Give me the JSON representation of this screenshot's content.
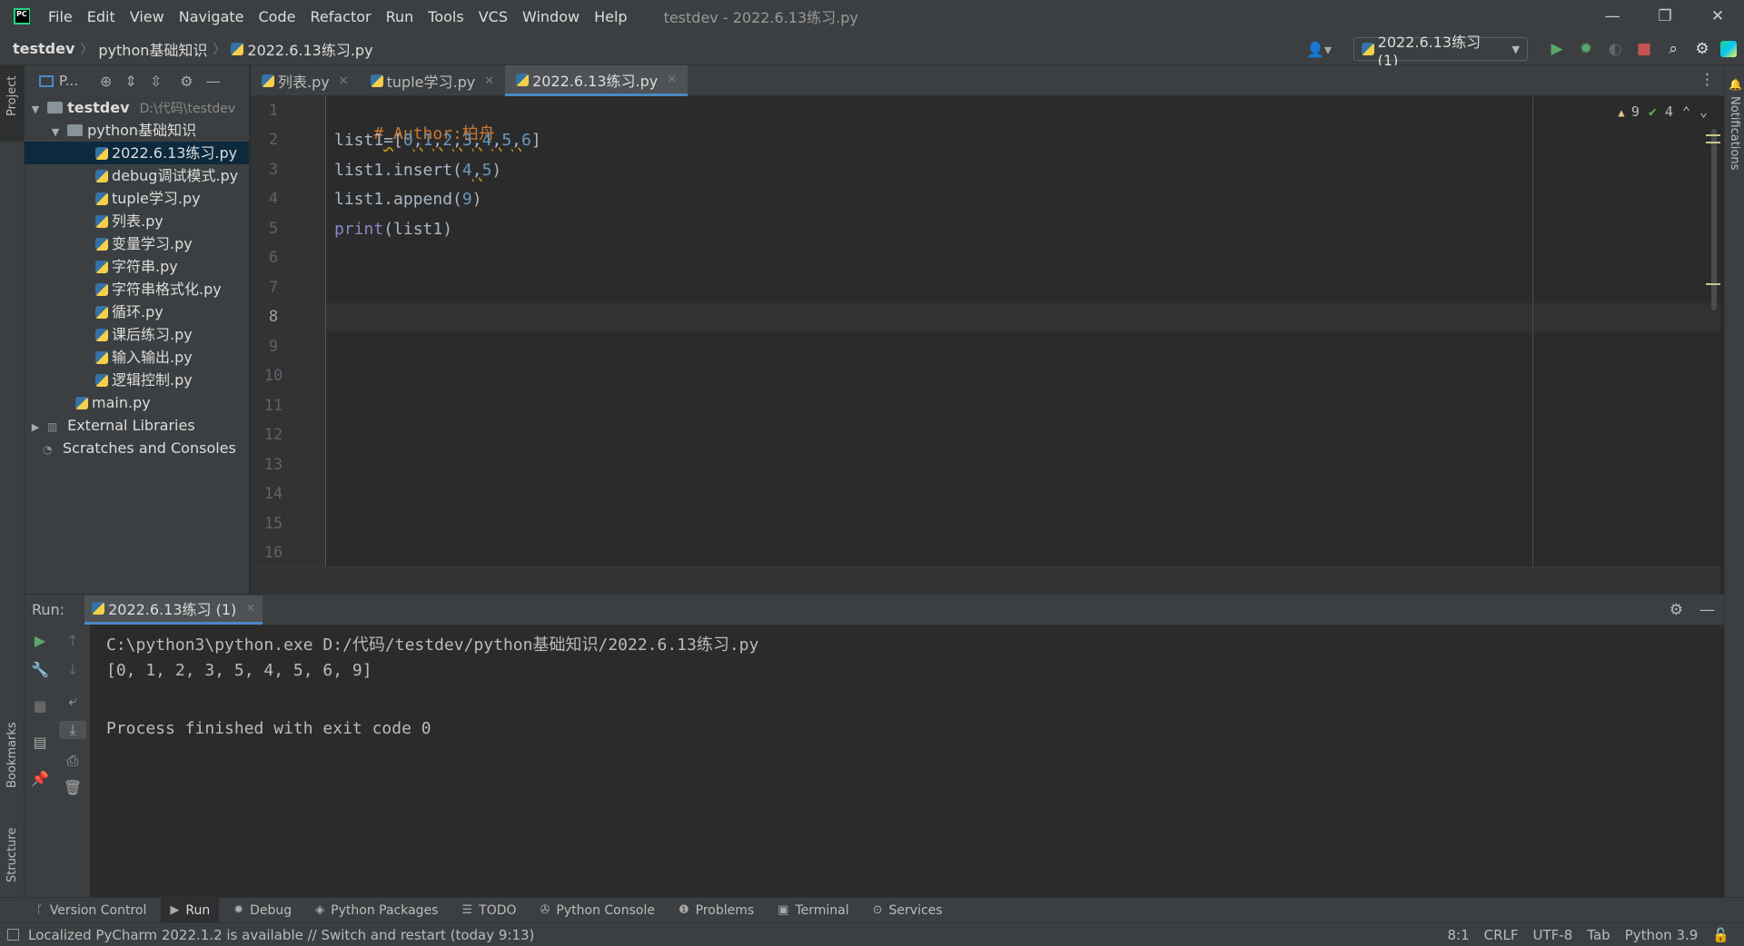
{
  "menu": [
    "File",
    "Edit",
    "View",
    "Navigate",
    "Code",
    "Refactor",
    "Run",
    "Tools",
    "VCS",
    "Window",
    "Help"
  ],
  "window_title": "testdev - 2022.6.13练习.py",
  "window_controls": [
    "—",
    "❐",
    "✕"
  ],
  "breadcrumb": [
    "testdev",
    "python基础知识",
    "2022.6.13练习.py"
  ],
  "run_config": "2022.6.13练习 (1)",
  "icons": {
    "run": "▶",
    "debug": "✹",
    "coverage": "◐",
    "stop": "■",
    "search": "⌕",
    "settings": "⚙",
    "user": "👤▾",
    "locate": "⊕",
    "expand": "⇕",
    "collapse": "⇳",
    "gear": "⚙",
    "minimize": "—",
    "more": "⋮",
    "close": "✕"
  },
  "left_strip": {
    "project": "Project",
    "bookmarks": "Bookmarks",
    "structure": "Structure"
  },
  "right_strip": {
    "notifications": "Notifications"
  },
  "project_panel": {
    "title": "P...",
    "root": {
      "name": "testdev",
      "path": "D:\\代码\\testdev"
    },
    "folder": "python基础知识",
    "files": [
      "2022.6.13练习.py",
      "debug调试模式.py",
      "tuple学习.py",
      "列表.py",
      "变量学习.py",
      "字符串.py",
      "字符串格式化.py",
      "循环.py",
      "课后练习.py",
      "输入输出.py",
      "逻辑控制.py"
    ],
    "main_file": "main.py",
    "external_libraries": "External Libraries",
    "scratches": "Scratches and Consoles"
  },
  "editor_tabs": [
    "列表.py",
    "tuple学习.py",
    "2022.6.13练习.py"
  ],
  "inspection": {
    "warnings": "9",
    "weak_warnings": "4"
  },
  "editor": {
    "line_numbers": [
      "1",
      "2",
      "3",
      "4",
      "5",
      "6",
      "7",
      "8",
      "9",
      "10",
      "11",
      "12",
      "13",
      "14",
      "15",
      "16"
    ],
    "comment": "# Author:柏舟",
    "line2": {
      "name": "list1",
      "eq": "=",
      "open": "[",
      "nums": [
        "0",
        "1",
        "2",
        "3",
        "4",
        "5",
        "6"
      ],
      "close": "]"
    },
    "line3": {
      "pre": "list1.insert(",
      "a": "4",
      "sep": ",",
      "b": "5",
      "post": ")"
    },
    "line4": {
      "pre": "list1.append(",
      "a": "9",
      "post": ")"
    },
    "line5": {
      "fn": "print",
      "args": "(list1)"
    }
  },
  "run": {
    "label": "Run:",
    "tab": "2022.6.13练习 (1)",
    "output": [
      "C:\\python3\\python.exe D:/代码/testdev/python基础知识/2022.6.13练习.py",
      "[0, 1, 2, 3, 5, 4, 5, 6, 9]",
      "",
      "Process finished with exit code 0"
    ]
  },
  "tool_windows": [
    "Version Control",
    "Run",
    "Debug",
    "Python Packages",
    "TODO",
    "Python Console",
    "Problems",
    "Terminal",
    "Services"
  ],
  "status": {
    "message": "Localized PyCharm 2022.1.2 is available // Switch and restart (today 9:13)",
    "position": "8:1",
    "line_sep": "CRLF",
    "encoding": "UTF-8",
    "indent": "Tab",
    "interpreter": "Python 3.9"
  }
}
